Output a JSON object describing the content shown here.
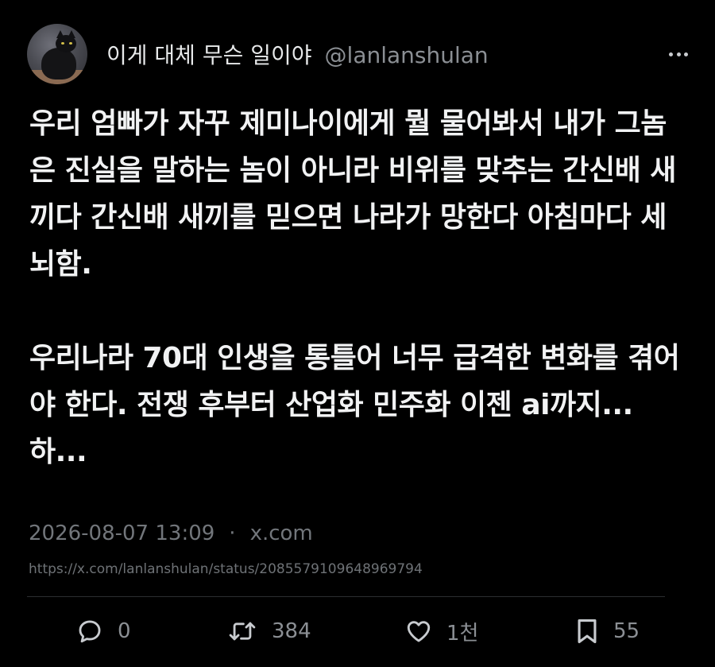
{
  "author": {
    "display_name": "이게 대체 무슨 일이야",
    "handle": "@lanlanshulan",
    "avatar_icon": "black-cat-avatar"
  },
  "menu_icon": "more-horizontal-icon",
  "tweet": {
    "paragraphs": [
      "우리 엄빠가 자꾸 제미나이에게 뭘 물어봐서 내가 그놈은 진실을 말하는 놈이 아니라 비위를 맞추는 간신배 새끼다 간신배 새끼를 믿으면 나라가 망한다 아침마다 세뇌함.",
      "우리나라 70대 인생을 통틀어 너무 급격한 변화를 겪어야 한다. 전쟁 후부터 산업화 민주화 이젠 ai까지... 하..."
    ],
    "timestamp": "2026-08-07 13:09",
    "separator": "·",
    "source": "x.com",
    "url": "https://x.com/lanlanshulan/status/2085579109648969794"
  },
  "actions": {
    "reply": {
      "icon": "reply-icon",
      "count": "0"
    },
    "retweet": {
      "icon": "retweet-icon",
      "count": "384"
    },
    "like": {
      "icon": "heart-icon",
      "count": "1천"
    },
    "bookmark": {
      "icon": "bookmark-icon",
      "count": "55"
    }
  },
  "colors": {
    "background": "#000000",
    "primary_text": "#e7e9ea",
    "secondary_text": "#8b8f94",
    "divider": "#2b2e31"
  }
}
